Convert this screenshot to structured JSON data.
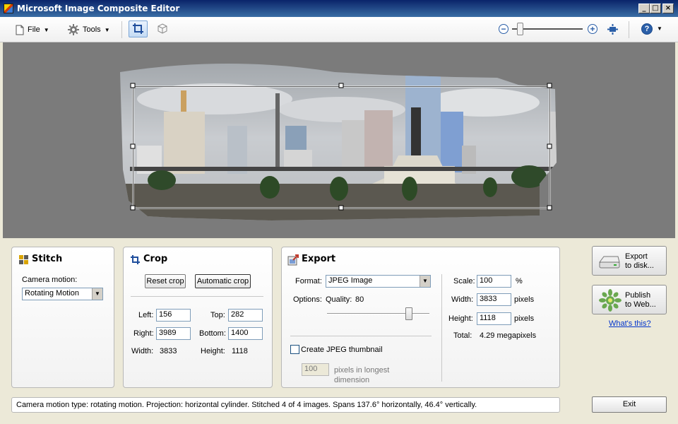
{
  "window": {
    "title": "Microsoft Image Composite Editor"
  },
  "toolbar": {
    "file_label": "File",
    "tools_label": "Tools"
  },
  "stitch": {
    "title": "Stitch",
    "camera_motion_label": "Camera motion:",
    "camera_motion_value": "Rotating Motion"
  },
  "crop": {
    "title": "Crop",
    "reset_label": "Reset crop",
    "auto_label": "Automatic crop",
    "left_label": "Left:",
    "left_value": "156",
    "top_label": "Top:",
    "top_value": "282",
    "right_label": "Right:",
    "right_value": "3989",
    "bottom_label": "Bottom:",
    "bottom_value": "1400",
    "width_label": "Width:",
    "width_value": "3833",
    "height_label": "Height:",
    "height_value": "1118"
  },
  "export": {
    "title": "Export",
    "format_label": "Format:",
    "format_value": "JPEG Image",
    "options_label": "Options:",
    "quality_label": "Quality:",
    "quality_value": "80",
    "quality_fraction": 0.8,
    "thumbnail_label": "Create JPEG thumbnail",
    "thumb_size_value": "100",
    "thumb_size_label": "pixels in longest dimension",
    "scale_label": "Scale:",
    "scale_value": "100",
    "scale_unit": "%",
    "width_label": "Width:",
    "width_value": "3833",
    "width_unit": "pixels",
    "height_label": "Height:",
    "height_value": "1118",
    "height_unit": "pixels",
    "total_label": "Total:",
    "total_value": "4.29 megapixels"
  },
  "actions": {
    "export_disk_line1": "Export",
    "export_disk_line2": "to disk...",
    "publish_web_line1": "Publish",
    "publish_web_line2": "to Web...",
    "whats_this": "What's this?",
    "exit": "Exit"
  },
  "status": {
    "text": "Camera motion type: rotating motion. Projection: horizontal cylinder. Stitched 4 of 4 images. Spans 137.6° horizontally, 46.4° vertically."
  },
  "colors": {
    "titlebar": "#0a246a",
    "canvas": "#7b7b7b",
    "link": "#0033cc"
  }
}
